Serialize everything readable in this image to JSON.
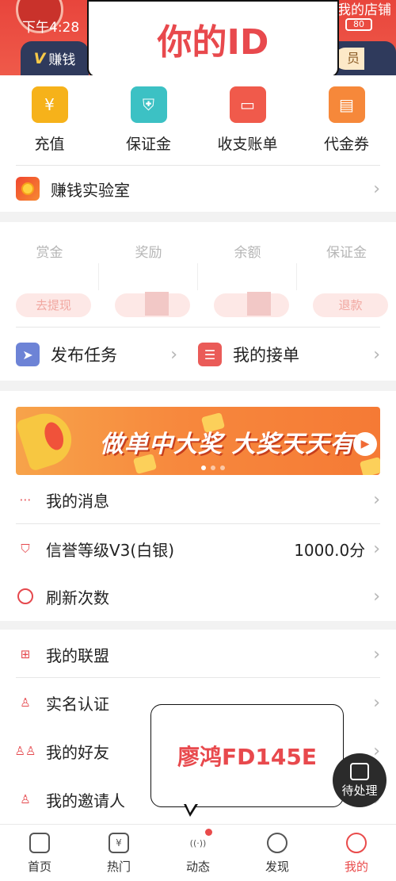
{
  "status_bar": {
    "time": "下午4:28",
    "battery": "80"
  },
  "header": {
    "shop_link": "我的店铺",
    "earn_badge_v": "V",
    "earn_badge_label": "赚钱",
    "member_pill": "员"
  },
  "overlay_id_bubble": "你的ID",
  "quick_actions": [
    {
      "label": "充值",
      "icon": "recharge-icon",
      "color": "#f6b21a"
    },
    {
      "label": "保证金",
      "icon": "shield-icon",
      "color": "#3cc1c4"
    },
    {
      "label": "收支账单",
      "icon": "wallet-icon",
      "color": "#f05a4b"
    },
    {
      "label": "代金券",
      "icon": "coupon-icon",
      "color": "#f6883a"
    }
  ],
  "lab_row": {
    "label": "赚钱实验室"
  },
  "stats": [
    {
      "label": "赏金",
      "button": "去提现"
    },
    {
      "label": "奖励",
      "button": "去"
    },
    {
      "label": "余额",
      "button": ""
    },
    {
      "label": "保证金",
      "button": "退款"
    }
  ],
  "task_row": {
    "publish": "发布任务",
    "orders": "我的接单"
  },
  "banner": {
    "text": "做单中大奖 大奖天天有"
  },
  "menu_a": [
    {
      "label": "我的消息",
      "icon": "message-icon",
      "value": ""
    },
    {
      "label": "信誉等级V3(白银)",
      "icon": "badge-icon",
      "value": "1000.0分"
    },
    {
      "label": "刷新次数",
      "icon": "refresh-icon",
      "value": ""
    }
  ],
  "menu_b": [
    {
      "label": "我的联盟",
      "icon": "bookmark-icon"
    },
    {
      "label": "实名认证",
      "icon": "user-check-icon"
    },
    {
      "label": "我的好友",
      "icon": "users-icon"
    },
    {
      "label": "我的邀请人",
      "icon": "user-share-icon"
    }
  ],
  "overlay_name_bubble": "廖鸿FD145E",
  "pending_fab": "待处理",
  "bottom_nav": [
    {
      "label": "首页",
      "icon": "home-icon",
      "glyph": ""
    },
    {
      "label": "热门",
      "icon": "hot-icon",
      "glyph": "¥"
    },
    {
      "label": "动态",
      "icon": "feed-icon",
      "glyph": "((·))"
    },
    {
      "label": "发现",
      "icon": "compass-icon",
      "glyph": ""
    },
    {
      "label": "我的",
      "icon": "profile-icon",
      "glyph": ""
    }
  ],
  "colors": {
    "accent": "#e8453c",
    "highlight_text": "#e8494d"
  }
}
